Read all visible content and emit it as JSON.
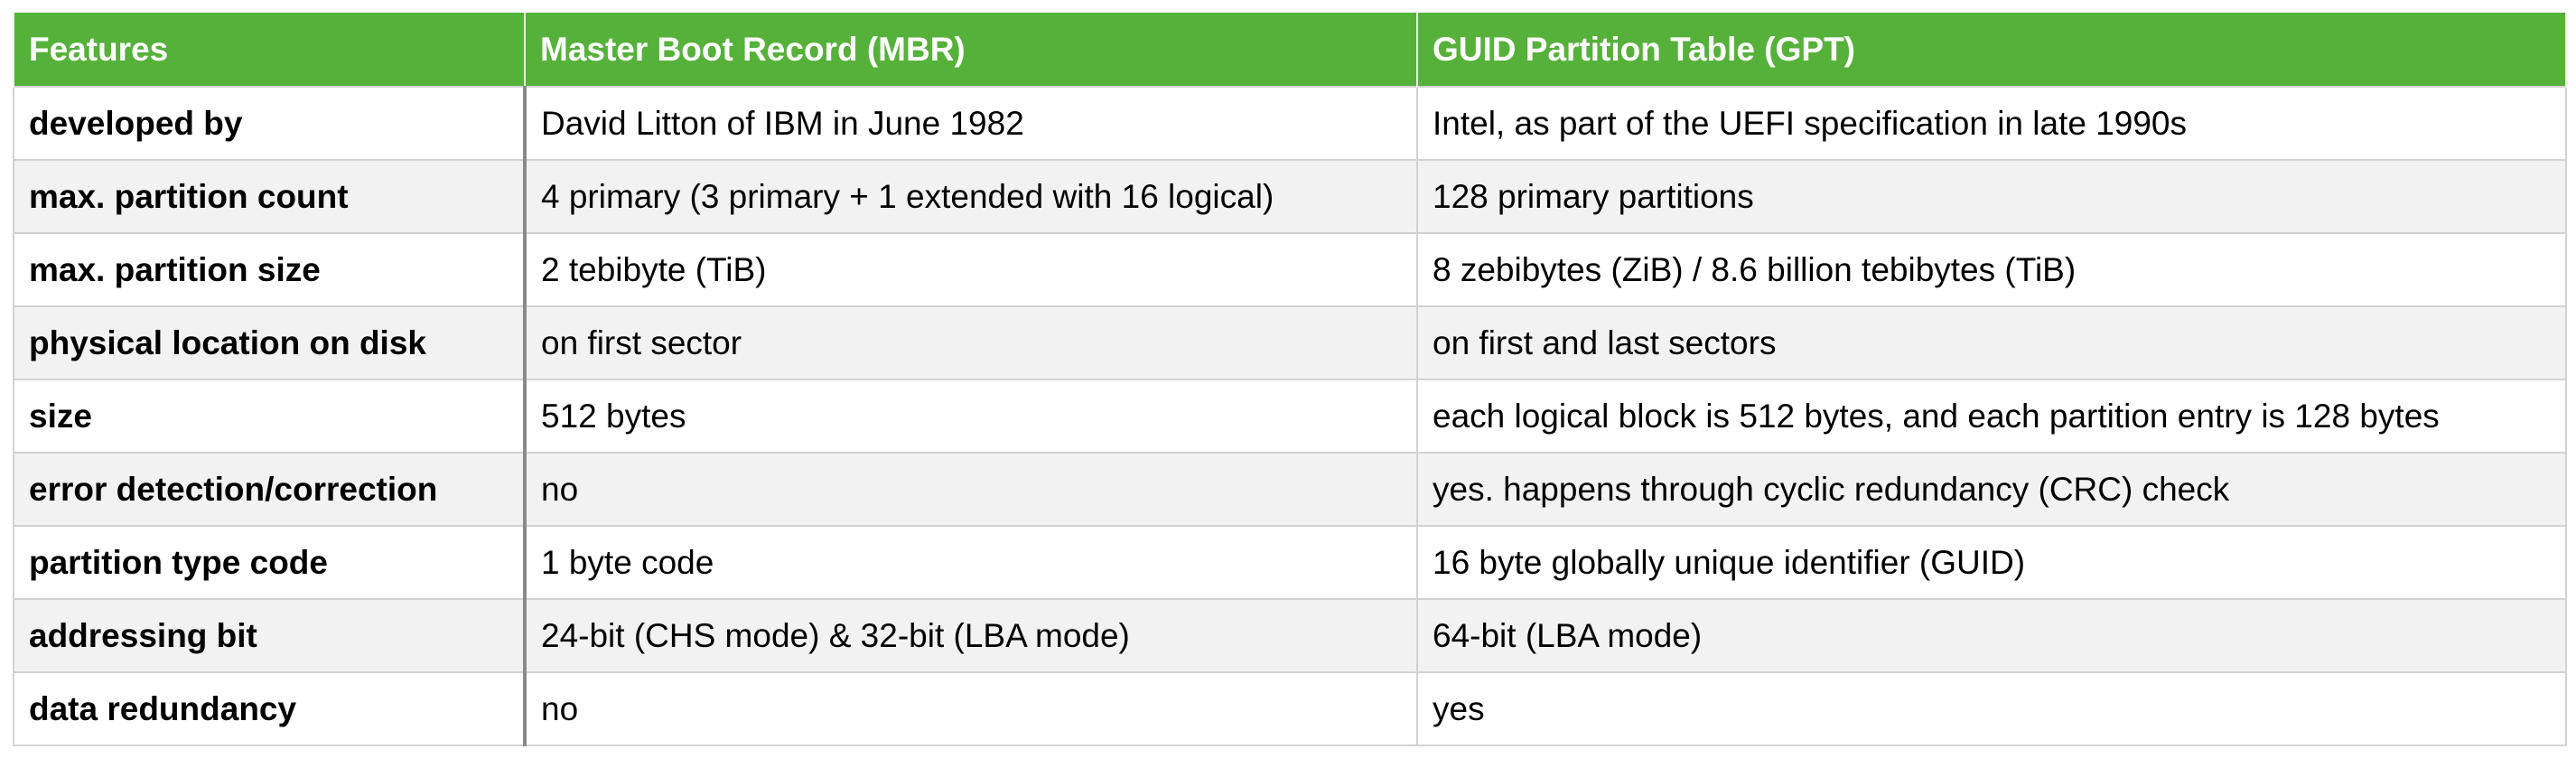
{
  "table": {
    "headers": [
      "Features",
      "Master Boot Record (MBR)",
      "GUID Partition Table (GPT)"
    ],
    "rows": [
      [
        "developed by",
        "David Litton of IBM in June 1982",
        "Intel, as part of the UEFI specification in late 1990s"
      ],
      [
        "max. partition count",
        "4 primary (3 primary + 1 extended with 16 logical)",
        "128 primary partitions"
      ],
      [
        "max. partition size",
        "2 tebibyte (TiB)",
        "8 zebibytes (ZiB) / 8.6 billion tebibytes (TiB)"
      ],
      [
        "physical location on disk",
        "on first sector",
        "on first and last sectors"
      ],
      [
        "size",
        "512 bytes",
        "each logical block is 512 bytes, and each partition entry is 128 bytes"
      ],
      [
        "error detection/correction",
        "no",
        "yes. happens through cyclic redundancy (CRC) check"
      ],
      [
        "partition type code",
        "1 byte code",
        "16 byte globally unique identifier (GUID)"
      ],
      [
        "addressing bit",
        "24-bit (CHS mode) & 32-bit (LBA mode)",
        "64-bit (LBA mode)"
      ],
      [
        "data redundancy",
        "no",
        "yes"
      ]
    ]
  },
  "colors": {
    "header_bg": "#56b13b",
    "header_text": "#ffffff",
    "row_alt_bg": "#f2f2f2",
    "grid": "#d2d2d2"
  }
}
